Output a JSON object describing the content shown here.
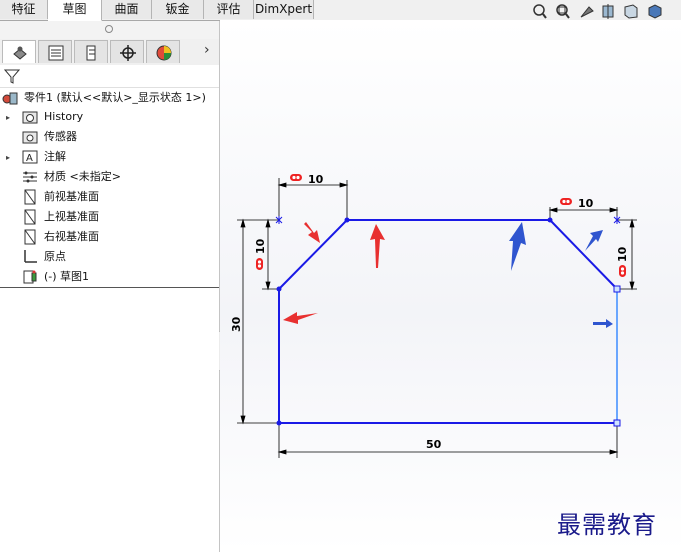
{
  "tabs": [
    "特征",
    "草图",
    "曲面",
    "钣金",
    "评估",
    "DimXpert"
  ],
  "active_tab": "草图",
  "tree": {
    "root": "零件1 (默认<<默认>_显示状态 1>)",
    "items": [
      "History",
      "传感器",
      "注解",
      "材质 <未指定>",
      "前视基准面",
      "上视基准面",
      "右视基准面",
      "原点",
      "(-) 草图1"
    ]
  },
  "dimensions": {
    "top_left_width": "10",
    "top_right_width": "10",
    "left_height": "10",
    "right_height": "10",
    "total_height": "30",
    "total_width": "50"
  },
  "colors": {
    "sketch_line": "#1a1ae6",
    "selected_line": "#3c8cff",
    "dimension": "#000000",
    "arrow_red": "#e83030",
    "arrow_blue": "#2f55cf"
  },
  "watermark": "最需教育"
}
